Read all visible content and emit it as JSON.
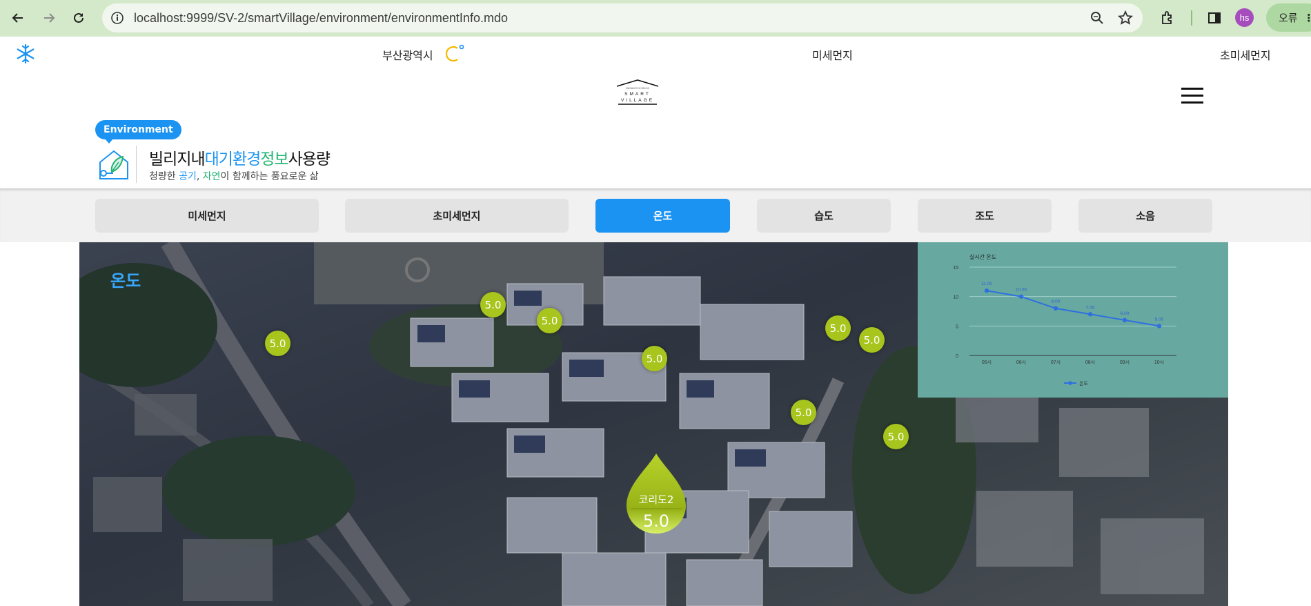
{
  "browser": {
    "url": "localhost:9999/SV-2/smartVillage/environment/environmentInfo.mdo",
    "profile_initials": "hs",
    "error_label": "오류"
  },
  "header": {
    "city": "부산광역시",
    "pm_label": "미세먼지",
    "ultra_pm_label": "초미세먼지",
    "logo_text_top": "BUSAN ECO DELTA",
    "logo_text_mid": "SMART",
    "logo_text_bottom": "VILLAGE"
  },
  "section": {
    "badge": "Environment",
    "title_a": "빌리지내",
    "title_b": "대기환경",
    "title_c": "정보",
    "title_d": "사용량",
    "sub_a": "청량한 ",
    "sub_b": "공기",
    "sub_c": ", ",
    "sub_d": "자연",
    "sub_e": "이 함께하는 풍요로운 삶"
  },
  "tabs": [
    {
      "label": "미세먼지",
      "active": false
    },
    {
      "label": "초미세먼지",
      "active": false
    },
    {
      "label": "온도",
      "active": true
    },
    {
      "label": "습도",
      "active": false
    },
    {
      "label": "조도",
      "active": false
    },
    {
      "label": "소음",
      "active": false
    }
  ],
  "map": {
    "title": "온도",
    "markers": [
      "5.0",
      "5.0",
      "5.0",
      "5.0",
      "5.0",
      "5.0",
      "5.0",
      "5.0",
      "5.0"
    ],
    "selected": {
      "name": "코리도2",
      "value": "5.0"
    }
  },
  "colors": {
    "accent": "#1a93f2",
    "marker": "#a7c51d",
    "chart_bg": "#67a9a1",
    "chart_line": "#2f6fe0"
  },
  "chart_data": {
    "type": "line",
    "title": "실시간 온도",
    "categories": [
      "05시",
      "06시",
      "07시",
      "08시",
      "09시",
      "10시"
    ],
    "series": [
      {
        "name": "온도",
        "values": [
          11.0,
          10.0,
          8.0,
          7.0,
          6.0,
          5.0
        ],
        "labels": [
          "11.00",
          "10.00",
          "8.00",
          "7.00",
          "6.00",
          "5.00"
        ]
      }
    ],
    "yticks": [
      "0",
      "5",
      "10",
      "15"
    ],
    "ylim": [
      0,
      15
    ],
    "grid": true,
    "legend": "bottom"
  }
}
